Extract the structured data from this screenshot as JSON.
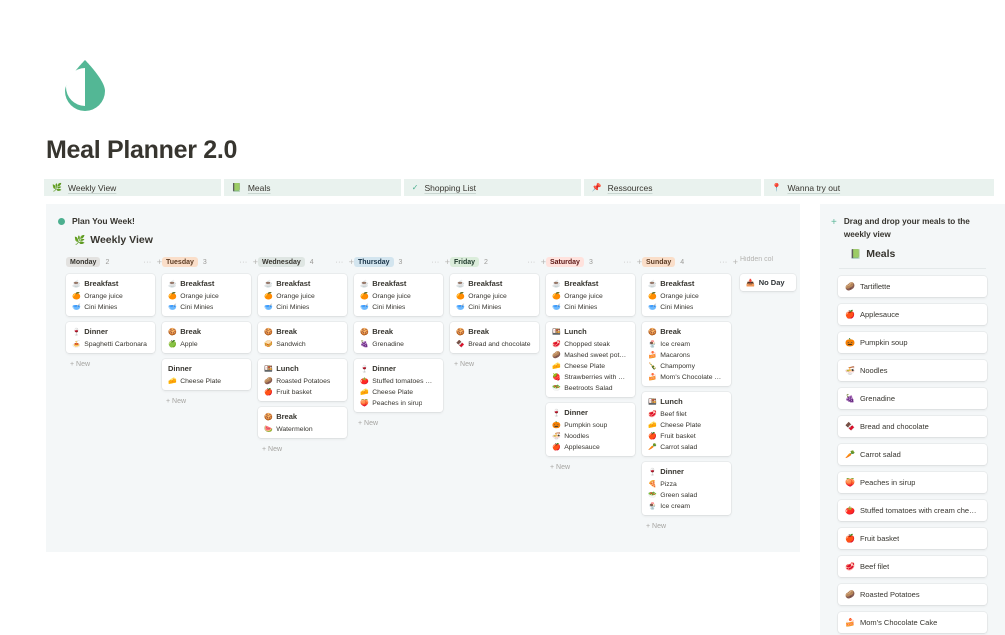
{
  "brand": {
    "logo_icon": "water-drop-icon",
    "logo_color": "#53b795"
  },
  "title": "Meal Planner 2.0",
  "tabs": [
    {
      "label": "Weekly View",
      "icon": "herb-sprout-icon",
      "glyph": "🌿"
    },
    {
      "label": "Meals",
      "icon": "green-book-icon",
      "glyph": "📗"
    },
    {
      "label": "Shopping List",
      "icon": "check-mark-icon",
      "glyph": "✓"
    },
    {
      "label": "Ressources",
      "icon": "pushpin-icon",
      "glyph": "📌"
    },
    {
      "label": "Wanna try out",
      "icon": "round-pushpin-icon",
      "glyph": "📍"
    }
  ],
  "board": {
    "header": "Plan You Week!",
    "view_title": "Weekly View",
    "view_icon": "herb-sprout-icon",
    "view_glyph": "🌿",
    "new_label": "+ New",
    "hidden_columns_label": "Hidden col",
    "no_day": {
      "label": "No Day",
      "icon": "inbox-tray-icon",
      "glyph": "📥"
    },
    "columns": [
      {
        "day": "Monday",
        "count": "2",
        "pill_bg": "#e3e2e0",
        "pill_fg": "#37352f",
        "cards": [
          {
            "title": "Breakfast",
            "glyph": "☕",
            "items": [
              {
                "glyph": "🍊",
                "text": "Orange juice"
              },
              {
                "glyph": "🥣",
                "text": "Cini Minies"
              }
            ]
          },
          {
            "title": "Dinner",
            "glyph": "🍷",
            "items": [
              {
                "glyph": "🍝",
                "text": "Spaghetti Carbonara"
              }
            ]
          }
        ],
        "show_new": true
      },
      {
        "day": "Tuesday",
        "count": "3",
        "pill_bg": "#fadec9",
        "pill_fg": "#5c3b23",
        "cards": [
          {
            "title": "Breakfast",
            "glyph": "☕",
            "items": [
              {
                "glyph": "🍊",
                "text": "Orange juice"
              },
              {
                "glyph": "🥣",
                "text": "Cini Minies"
              }
            ]
          },
          {
            "title": "Break",
            "glyph": "🍪",
            "items": [
              {
                "glyph": "🍏",
                "text": "Apple"
              }
            ]
          },
          {
            "title": "Dinner",
            "glyph": "",
            "items": [
              {
                "glyph": "🧀",
                "text": "Cheese Plate"
              }
            ]
          }
        ],
        "show_new": true
      },
      {
        "day": "Wednesday",
        "count": "4",
        "pill_bg": "#dfe6e3",
        "pill_fg": "#37352f",
        "cards": [
          {
            "title": "Breakfast",
            "glyph": "☕",
            "items": [
              {
                "glyph": "🍊",
                "text": "Orange juice"
              },
              {
                "glyph": "🥣",
                "text": "Cini Minies"
              }
            ]
          },
          {
            "title": "Break",
            "glyph": "🍪",
            "items": [
              {
                "glyph": "🥪",
                "text": "Sandwich"
              }
            ]
          },
          {
            "title": "Lunch",
            "glyph": "🍱",
            "items": [
              {
                "glyph": "🥔",
                "text": "Roasted Potatoes"
              },
              {
                "glyph": "🍎",
                "text": "Fruit basket"
              }
            ]
          },
          {
            "title": "Break",
            "glyph": "🍪",
            "items": [
              {
                "glyph": "🍉",
                "text": "Watermelon"
              }
            ]
          }
        ],
        "show_new": true
      },
      {
        "day": "Thursday",
        "count": "3",
        "pill_bg": "#d3e5ef",
        "pill_fg": "#183347",
        "cards": [
          {
            "title": "Breakfast",
            "glyph": "☕",
            "items": [
              {
                "glyph": "🍊",
                "text": "Orange juice"
              },
              {
                "glyph": "🥣",
                "text": "Cini Minies"
              }
            ]
          },
          {
            "title": "Break",
            "glyph": "🍪",
            "items": [
              {
                "glyph": "🍇",
                "text": "Grenadine"
              }
            ]
          },
          {
            "title": "Dinner",
            "glyph": "🍷",
            "items": [
              {
                "glyph": "🍅",
                "text": "Stuffed tomatoes w…"
              },
              {
                "glyph": "🧀",
                "text": "Cheese Plate"
              },
              {
                "glyph": "🍑",
                "text": "Peaches in sirup"
              }
            ]
          }
        ],
        "show_new": true
      },
      {
        "day": "Friday",
        "count": "2",
        "pill_bg": "#dbeddb",
        "pill_fg": "#1c3829",
        "cards": [
          {
            "title": "Breakfast",
            "glyph": "☕",
            "items": [
              {
                "glyph": "🍊",
                "text": "Orange juice"
              },
              {
                "glyph": "🥣",
                "text": "Cini Minies"
              }
            ]
          },
          {
            "title": "Break",
            "glyph": "🍪",
            "items": [
              {
                "glyph": "🍫",
                "text": "Bread and chocolate"
              }
            ]
          }
        ],
        "show_new": true
      },
      {
        "day": "Saturday",
        "count": "3",
        "pill_bg": "#ffe2dd",
        "pill_fg": "#5d1715",
        "cards": [
          {
            "title": "Breakfast",
            "glyph": "☕",
            "items": [
              {
                "glyph": "🍊",
                "text": "Orange juice"
              },
              {
                "glyph": "🥣",
                "text": "Cini Minies"
              }
            ]
          },
          {
            "title": "Lunch",
            "glyph": "🍱",
            "items": [
              {
                "glyph": "🥩",
                "text": "Chopped steak"
              },
              {
                "glyph": "🥔",
                "text": "Mashed sweet pota…"
              },
              {
                "glyph": "🧀",
                "text": "Cheese Plate"
              },
              {
                "glyph": "🍓",
                "text": "Strawberries with w…"
              },
              {
                "glyph": "🥗",
                "text": "Beetroots Salad"
              }
            ]
          },
          {
            "title": "Dinner",
            "glyph": "🍷",
            "items": [
              {
                "glyph": "🎃",
                "text": "Pumpkin soup"
              },
              {
                "glyph": "🍜",
                "text": "Noodles"
              },
              {
                "glyph": "🍎",
                "text": "Applesauce"
              }
            ]
          }
        ],
        "show_new": true
      },
      {
        "day": "Sunday",
        "count": "4",
        "pill_bg": "#fadec9",
        "pill_fg": "#5c3b23",
        "cards": [
          {
            "title": "Breakfast",
            "glyph": "☕",
            "items": [
              {
                "glyph": "🍊",
                "text": "Orange juice"
              },
              {
                "glyph": "🥣",
                "text": "Cini Minies"
              }
            ]
          },
          {
            "title": "Break",
            "glyph": "🍪",
            "items": [
              {
                "glyph": "🍨",
                "text": "Ice cream"
              },
              {
                "glyph": "🍰",
                "text": "Macarons"
              },
              {
                "glyph": "🍾",
                "text": "Champomy"
              },
              {
                "glyph": "🍰",
                "text": "Mom's Chocolate C…"
              }
            ]
          },
          {
            "title": "Lunch",
            "glyph": "🍱",
            "items": [
              {
                "glyph": "🥩",
                "text": "Beef filet"
              },
              {
                "glyph": "🧀",
                "text": "Cheese Plate"
              },
              {
                "glyph": "🍎",
                "text": "Fruit basket"
              },
              {
                "glyph": "🥕",
                "text": "Carrot salad"
              }
            ]
          },
          {
            "title": "Dinner",
            "glyph": "🍷",
            "items": [
              {
                "glyph": "🍕",
                "text": "Pizza"
              },
              {
                "glyph": "🥗",
                "text": "Green salad"
              },
              {
                "glyph": "🍨",
                "text": "Ice cream"
              }
            ]
          }
        ],
        "show_new": true
      }
    ]
  },
  "panel": {
    "header": "Drag and drop your meals to the weekly view",
    "sub_title": "Meals",
    "sub_icon": "green-book-icon",
    "sub_glyph": "📗",
    "meals": [
      {
        "glyph": "🥔",
        "text": "Tartiflette"
      },
      {
        "glyph": "🍎",
        "text": "Applesauce"
      },
      {
        "glyph": "🎃",
        "text": "Pumpkin soup"
      },
      {
        "glyph": "🍜",
        "text": "Noodles"
      },
      {
        "glyph": "🍇",
        "text": "Grenadine"
      },
      {
        "glyph": "🍫",
        "text": "Bread and chocolate"
      },
      {
        "glyph": "🥕",
        "text": "Carrot salad"
      },
      {
        "glyph": "🍑",
        "text": "Peaches in sirup"
      },
      {
        "glyph": "🍅",
        "text": "Stuffed tomatoes with cream che…"
      },
      {
        "glyph": "🍎",
        "text": "Fruit basket"
      },
      {
        "glyph": "🥩",
        "text": "Beef filet"
      },
      {
        "glyph": "🥔",
        "text": "Roasted Potatoes"
      },
      {
        "glyph": "🍰",
        "text": "Mom's Chocolate Cake"
      }
    ]
  }
}
